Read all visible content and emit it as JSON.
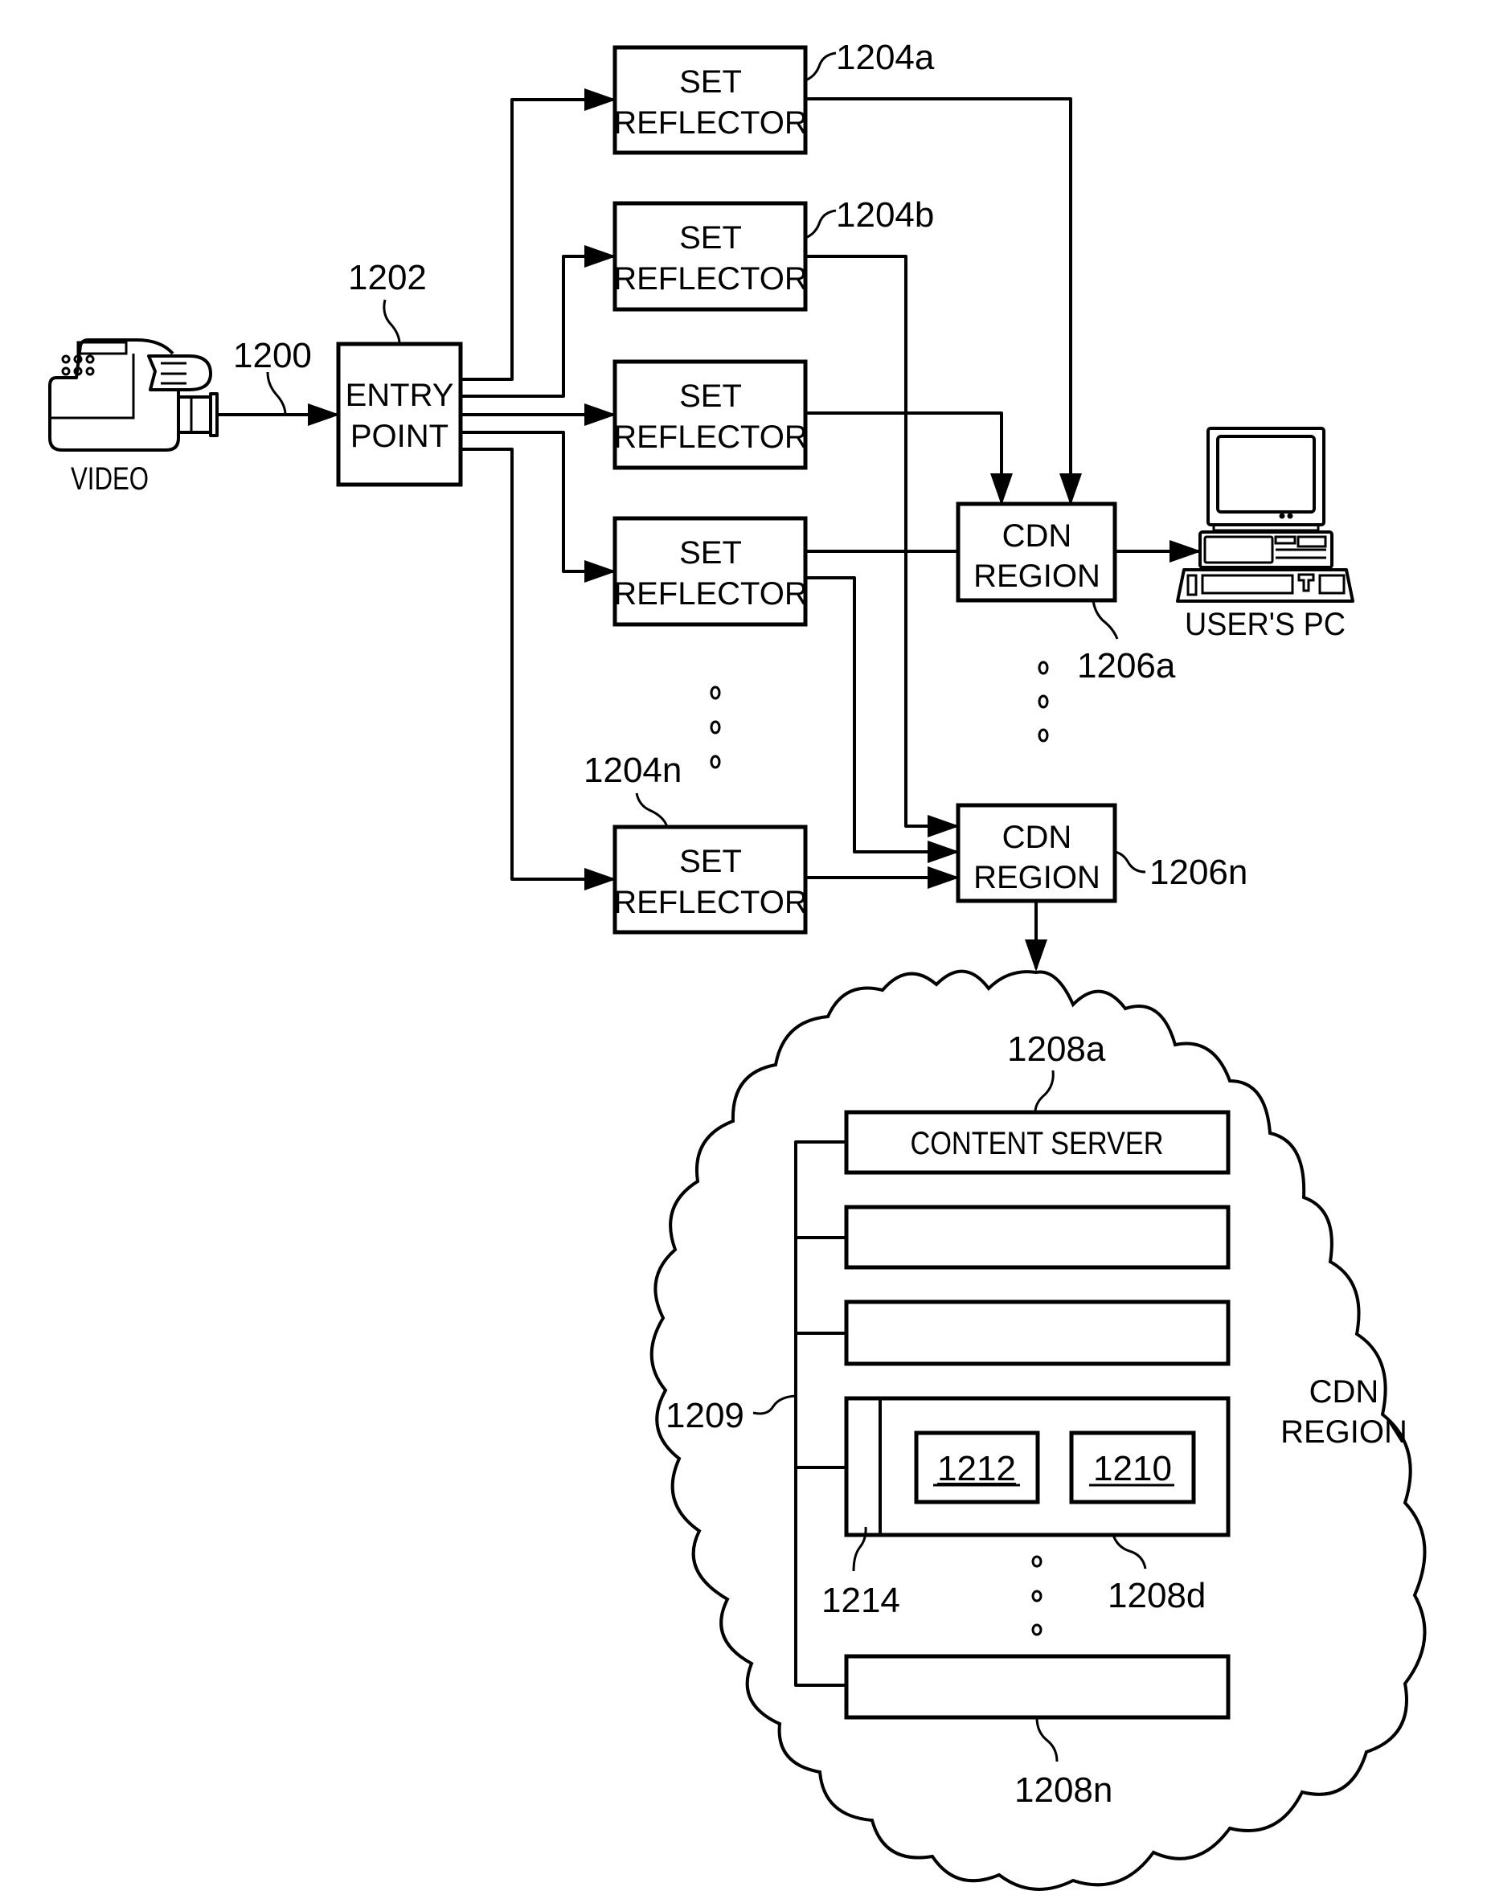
{
  "figure": {
    "type": "block-diagram",
    "description": "Live video stream distribution through an entry point, set reflectors and CDN regions"
  },
  "source": {
    "label": "VIDEO",
    "ref": "1200",
    "icon": "video-camera-icon"
  },
  "entry_point": {
    "label_line1": "ENTRY",
    "label_line2": "POINT",
    "ref": "1202"
  },
  "reflectors": [
    {
      "label_line1": "SET",
      "label_line2": "REFLECTOR",
      "ref": "1204a"
    },
    {
      "label_line1": "SET",
      "label_line2": "REFLECTOR",
      "ref": "1204b"
    },
    {
      "label_line1": "SET",
      "label_line2": "REFLECTOR",
      "ref": ""
    },
    {
      "label_line1": "SET",
      "label_line2": "REFLECTOR",
      "ref": ""
    },
    {
      "label_line1": "SET",
      "label_line2": "REFLECTOR",
      "ref": "1204n"
    }
  ],
  "cdn_regions": [
    {
      "label_line1": "CDN",
      "label_line2": "REGION",
      "ref": "1206a"
    },
    {
      "label_line1": "CDN",
      "label_line2": "REGION",
      "ref": "1206n"
    }
  ],
  "user_pc": {
    "label": "USER'S PC",
    "icon": "desktop-computer-icon"
  },
  "cloud": {
    "label_line1": "CDN",
    "label_line2": "REGION",
    "bus_ref": "1209",
    "servers": [
      {
        "label": "CONTENT SERVER",
        "ref": "1208a"
      },
      {
        "label": "",
        "ref": ""
      },
      {
        "label": "",
        "ref": ""
      },
      {
        "label": "",
        "ref": "1208d",
        "strip_ref": "1214",
        "inner": [
          "1212",
          "1210"
        ]
      },
      {
        "label": "",
        "ref": "1208n"
      }
    ]
  },
  "ellipsis": "°"
}
